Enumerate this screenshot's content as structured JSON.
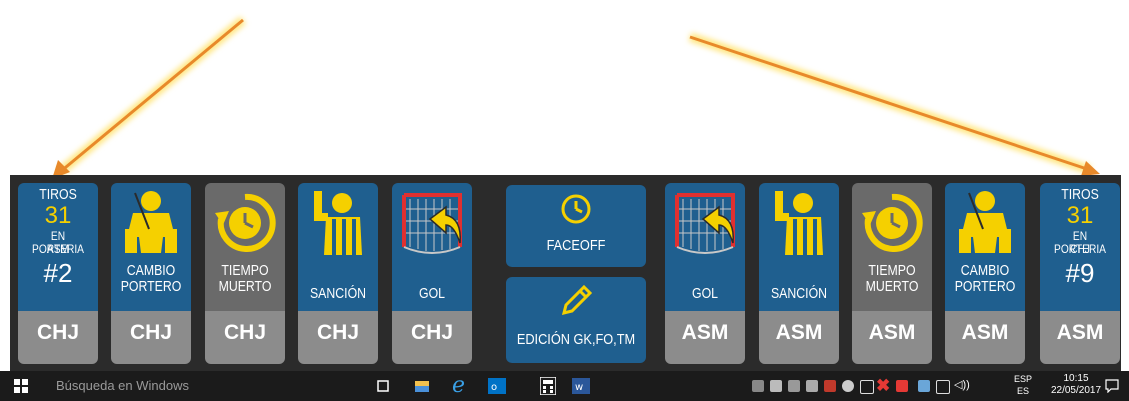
{
  "tiles": [
    {
      "type": "shots",
      "label_top": "TIROS",
      "count": "31",
      "label_mid": "EN PORTERIA",
      "label_team": "ASM",
      "player": "#2",
      "team": "CHJ"
    },
    {
      "type": "action",
      "icon": "goalie-icon",
      "label": [
        "CAMBIO",
        "PORTERO"
      ],
      "team": "CHJ"
    },
    {
      "type": "action",
      "icon": "timeout-clock-icon",
      "label": [
        "TIEMPO",
        "MUERTO"
      ],
      "team": "CHJ"
    },
    {
      "type": "action",
      "icon": "referee-icon",
      "label": [
        "SANCIÓN"
      ],
      "team": "CHJ"
    },
    {
      "type": "action",
      "icon": "goal-net-icon",
      "label": [
        "GOL"
      ],
      "team": "CHJ"
    },
    {
      "type": "action",
      "icon": "goal-net-icon",
      "label": [
        "GOL"
      ],
      "team": "ASM"
    },
    {
      "type": "action",
      "icon": "referee-icon",
      "label": [
        "SANCIÓN"
      ],
      "team": "ASM"
    },
    {
      "type": "action",
      "icon": "timeout-clock-icon",
      "label": [
        "TIEMPO",
        "MUERTO"
      ],
      "team": "ASM"
    },
    {
      "type": "action",
      "icon": "goalie-icon",
      "label": [
        "CAMBIO",
        "PORTERO"
      ],
      "team": "ASM"
    },
    {
      "type": "shots",
      "label_top": "TIROS",
      "count": "31",
      "label_mid": "EN PORTERIA",
      "label_team": "CHJ",
      "player": "#9",
      "team": "ASM"
    }
  ],
  "center_buttons": {
    "faceoff": {
      "label": "FACEOFF",
      "icon": "clock-icon"
    },
    "edit": {
      "label": "EDICIÓN GK,FO,TM",
      "icon": "pencil-icon"
    }
  },
  "taskbar": {
    "search_placeholder": "Búsqueda en Windows",
    "language_top": "ESP",
    "language_bottom": "ES",
    "time": "10:15",
    "date": "22/05/2017"
  },
  "colors": {
    "tile_blue": "#1f5f8f",
    "tile_gray": "#6a6a6a",
    "team_bar": "#8c8c8c",
    "icon_yellow": "#f5d000",
    "panel": "#2b2b2b",
    "arrow": "#e8892a",
    "arrow_glow": "#ffe680"
  }
}
